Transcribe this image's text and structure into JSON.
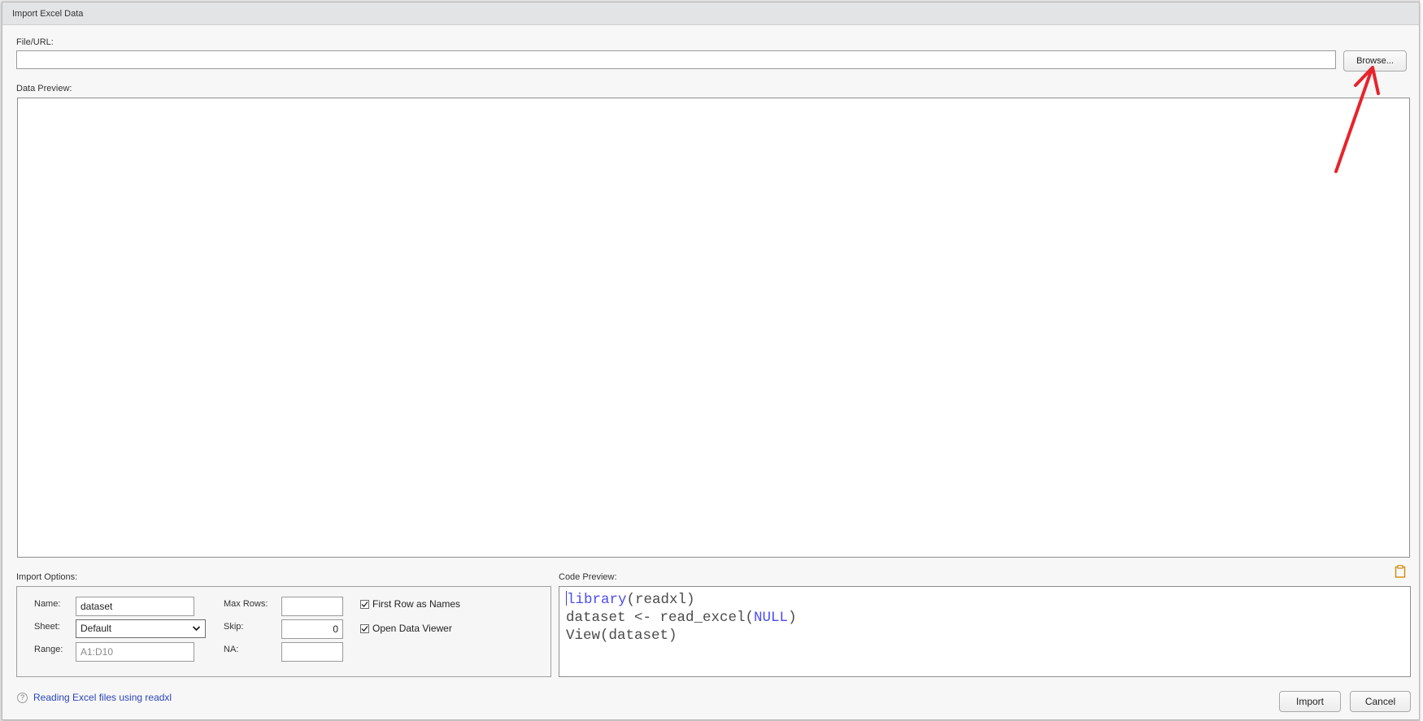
{
  "window": {
    "title": "Import Excel Data"
  },
  "file_url": {
    "label": "File/URL:",
    "value": "",
    "browse_label": "Browse..."
  },
  "data_preview": {
    "label": "Data Preview:"
  },
  "import_options": {
    "label": "Import Options:",
    "name_label": "Name:",
    "name_value": "dataset",
    "sheet_label": "Sheet:",
    "sheet_value": "Default",
    "range_label": "Range:",
    "range_placeholder": "A1:D10",
    "max_rows_label": "Max Rows:",
    "max_rows_value": "",
    "skip_label": "Skip:",
    "skip_value": "0",
    "na_label": "NA:",
    "na_value": "",
    "first_row_label": "First Row as Names",
    "first_row_checked": true,
    "open_viewer_label": "Open Data Viewer",
    "open_viewer_checked": true
  },
  "code_preview": {
    "label": "Code Preview:",
    "line1_kw": "library",
    "line1_rest": "(readxl)",
    "line2_pre": "dataset <- read_excel(",
    "line2_kw": "NULL",
    "line2_post": ")",
    "line3": "View(dataset)"
  },
  "help": {
    "link_text": "Reading Excel files using readxl",
    "icon": "?"
  },
  "buttons": {
    "import": "Import",
    "cancel": "Cancel"
  },
  "colors": {
    "annotation_arrow": "#e8232b",
    "code_keyword": "#4c4cf0",
    "link": "#2a44b8"
  }
}
